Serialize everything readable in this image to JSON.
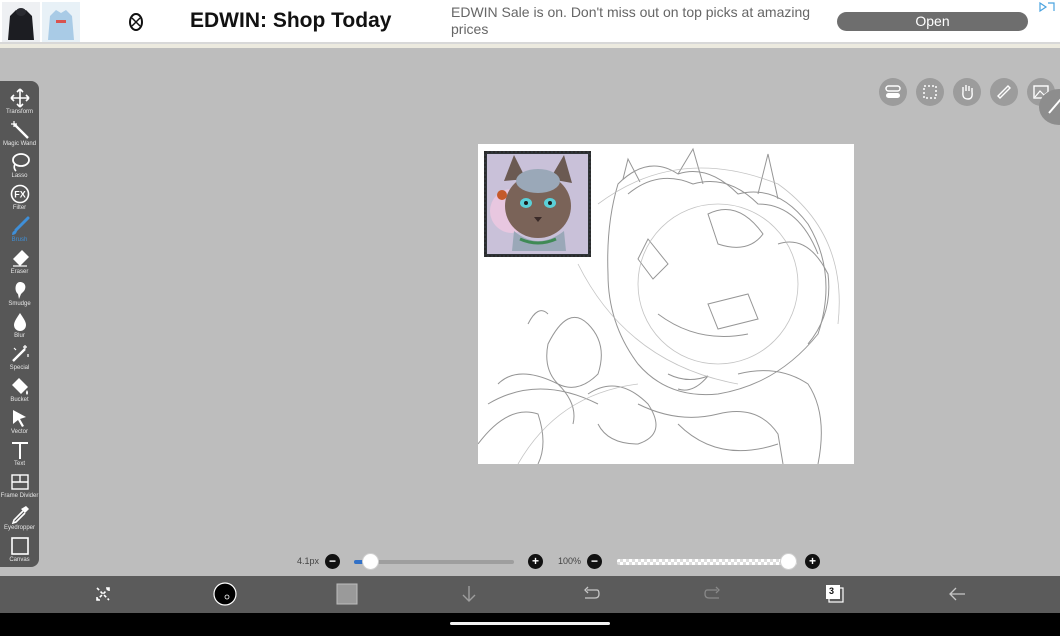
{
  "ad": {
    "title": "EDWIN: Shop Today",
    "description": "EDWIN Sale is on. Don't miss out on top picks at amazing prices",
    "open_label": "Open"
  },
  "tools": [
    {
      "label": "Transform",
      "icon": "move-icon"
    },
    {
      "label": "Magic Wand",
      "icon": "magic-wand-icon"
    },
    {
      "label": "Lasso",
      "icon": "lasso-icon"
    },
    {
      "label": "Filter",
      "icon": "fx-icon"
    },
    {
      "label": "Brush",
      "icon": "brush-icon",
      "active": true
    },
    {
      "label": "Eraser",
      "icon": "eraser-icon"
    },
    {
      "label": "Smudge",
      "icon": "smudge-icon"
    },
    {
      "label": "Blur",
      "icon": "drop-icon"
    },
    {
      "label": "Special",
      "icon": "special-wand-icon"
    },
    {
      "label": "Bucket",
      "icon": "bucket-icon"
    },
    {
      "label": "Vector",
      "icon": "cursor-icon"
    },
    {
      "label": "Text",
      "icon": "text-icon"
    },
    {
      "label": "Frame Divider",
      "icon": "frame-divider-icon"
    },
    {
      "label": "Eyedropper",
      "icon": "eyedropper-icon"
    },
    {
      "label": "Canvas",
      "icon": "canvas-icon"
    }
  ],
  "brush_size": {
    "label": "4.1px",
    "value_fraction": 0.06
  },
  "opacity": {
    "label": "100%",
    "value_fraction": 1.0
  },
  "layers_count": "3",
  "colors": {
    "accent": "#3271c7",
    "toolbar": "#575757",
    "canvas_bg": "#bdbdbd",
    "secondary_swatch": "#9a9a9a"
  }
}
